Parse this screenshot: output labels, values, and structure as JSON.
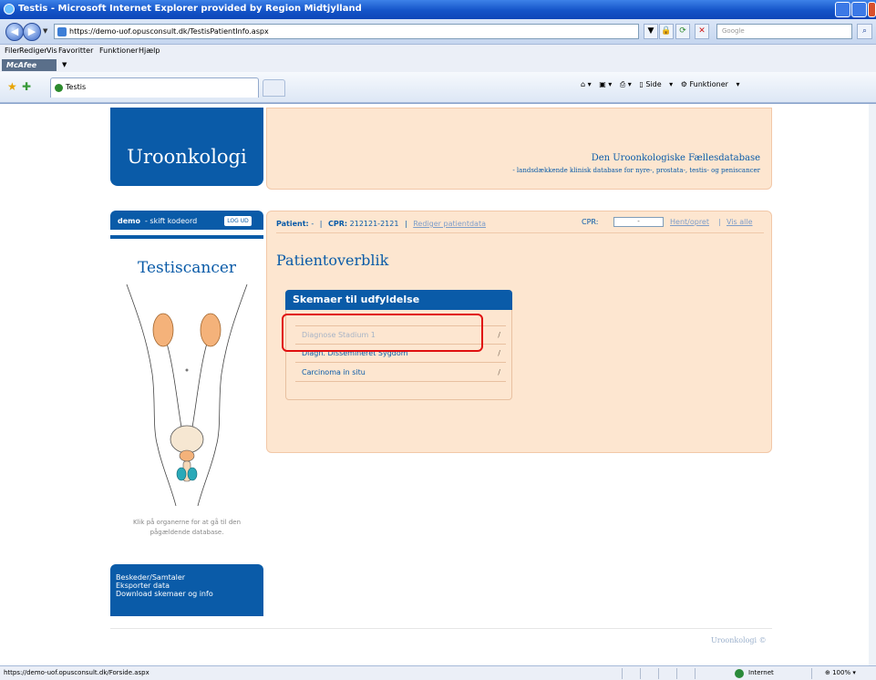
{
  "window": {
    "title": "Testis - Microsoft Internet Explorer provided by Region Midtjylland"
  },
  "address_bar": {
    "url": "https://demo-uof.opusconsult.dk/TestisPatientInfo.aspx",
    "search_placeholder": "Google"
  },
  "menu": {
    "items": [
      "Filer",
      "Rediger",
      "Vis",
      "Favoritter",
      "Funktioner",
      "Hjælp"
    ]
  },
  "toolbar": {
    "mcafee_label": "McAfee"
  },
  "tabs": {
    "active_label": "Testis"
  },
  "command_bar": {
    "page_label": "Side",
    "tools_label": "Funktioner"
  },
  "header": {
    "logo_text": "Uroonkologi",
    "title": "Den Uroonkologiske Fællesdatabase",
    "subtitle": "- landsdækkende klinisk database for nyre-, prostata-, testis- og peniscancer"
  },
  "user_panel": {
    "user": "demo",
    "change_password": "- skift kodeord",
    "logout": "LOG UD"
  },
  "sidebar": {
    "section_title": "Testiscancer",
    "caption_line1": "Klik på organerne for at gå til den",
    "caption_line2": "pågældende database.",
    "links": [
      "Beskeder/Samtaler",
      "Eksporter data",
      "Download skemaer og info"
    ]
  },
  "patient_bar": {
    "patient_label": "Patient:",
    "patient_value": "-",
    "cpr_label": "CPR:",
    "cpr_value": "212121-2121",
    "edit_link": "Rediger patientdata",
    "search_cpr_label": "CPR:",
    "search_cpr_value": "-",
    "fetch_link": "Hent/opret",
    "show_all_link": "Vis alle"
  },
  "main": {
    "heading": "Patientoverblik"
  },
  "forms_panel": {
    "title": "Skemaer til udfyldelse",
    "rows": [
      {
        "label": "Diagnose Stadium 1",
        "mark": "/"
      },
      {
        "label": "Diagn. Dissemineret Sygdom",
        "mark": "/"
      },
      {
        "label": "Carcinoma in situ",
        "mark": "/"
      }
    ]
  },
  "footer": {
    "text": "Uroonkologi ©"
  },
  "status_bar": {
    "url": "https://demo-uof.opusconsult.dk/Forside.aspx",
    "zone": "Internet",
    "zoom": "100%"
  },
  "colors": {
    "brand_blue": "#0a5ba8",
    "panel_peach": "#fde6d0",
    "highlight_red": "#e01010"
  }
}
